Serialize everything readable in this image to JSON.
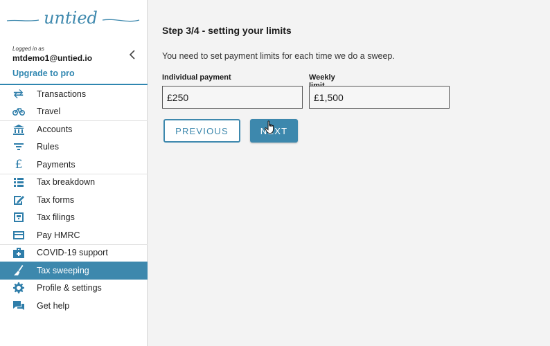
{
  "brand": {
    "logo_text": "untied",
    "accent": "#2f86b0"
  },
  "user": {
    "logged_in_label": "Logged in as",
    "email": "mtdemo1@untied.io",
    "upgrade_label": "Upgrade to pro"
  },
  "sidebar": {
    "items": [
      {
        "label": "Transactions",
        "icon": "arrows-exchange-icon"
      },
      {
        "label": "Travel",
        "icon": "bicycle-icon"
      },
      {
        "label": "Accounts",
        "icon": "bank-icon"
      },
      {
        "label": "Rules",
        "icon": "filter-icon"
      },
      {
        "label": "Payments",
        "icon": "pound-icon"
      },
      {
        "label": "Tax breakdown",
        "icon": "list-icon"
      },
      {
        "label": "Tax forms",
        "icon": "form-edit-icon"
      },
      {
        "label": "Tax filings",
        "icon": "filing-icon"
      },
      {
        "label": "Pay HMRC",
        "icon": "credit-card-icon"
      },
      {
        "label": "COVID-19 support",
        "icon": "medical-kit-icon"
      },
      {
        "label": "Tax sweeping",
        "icon": "broom-icon",
        "active": true
      },
      {
        "label": "Profile & settings",
        "icon": "gear-icon"
      },
      {
        "label": "Get help",
        "icon": "chat-icon"
      }
    ]
  },
  "step": {
    "title": "Step 3/4 - setting your limits",
    "description": "You need to set payment limits for each time we do a sweep."
  },
  "form": {
    "individual_label": "Individual payment",
    "individual_value": "£250",
    "weekly_label": "Weekly limit",
    "weekly_value": "£1,500"
  },
  "buttons": {
    "previous": "Previous",
    "next": "Next"
  }
}
